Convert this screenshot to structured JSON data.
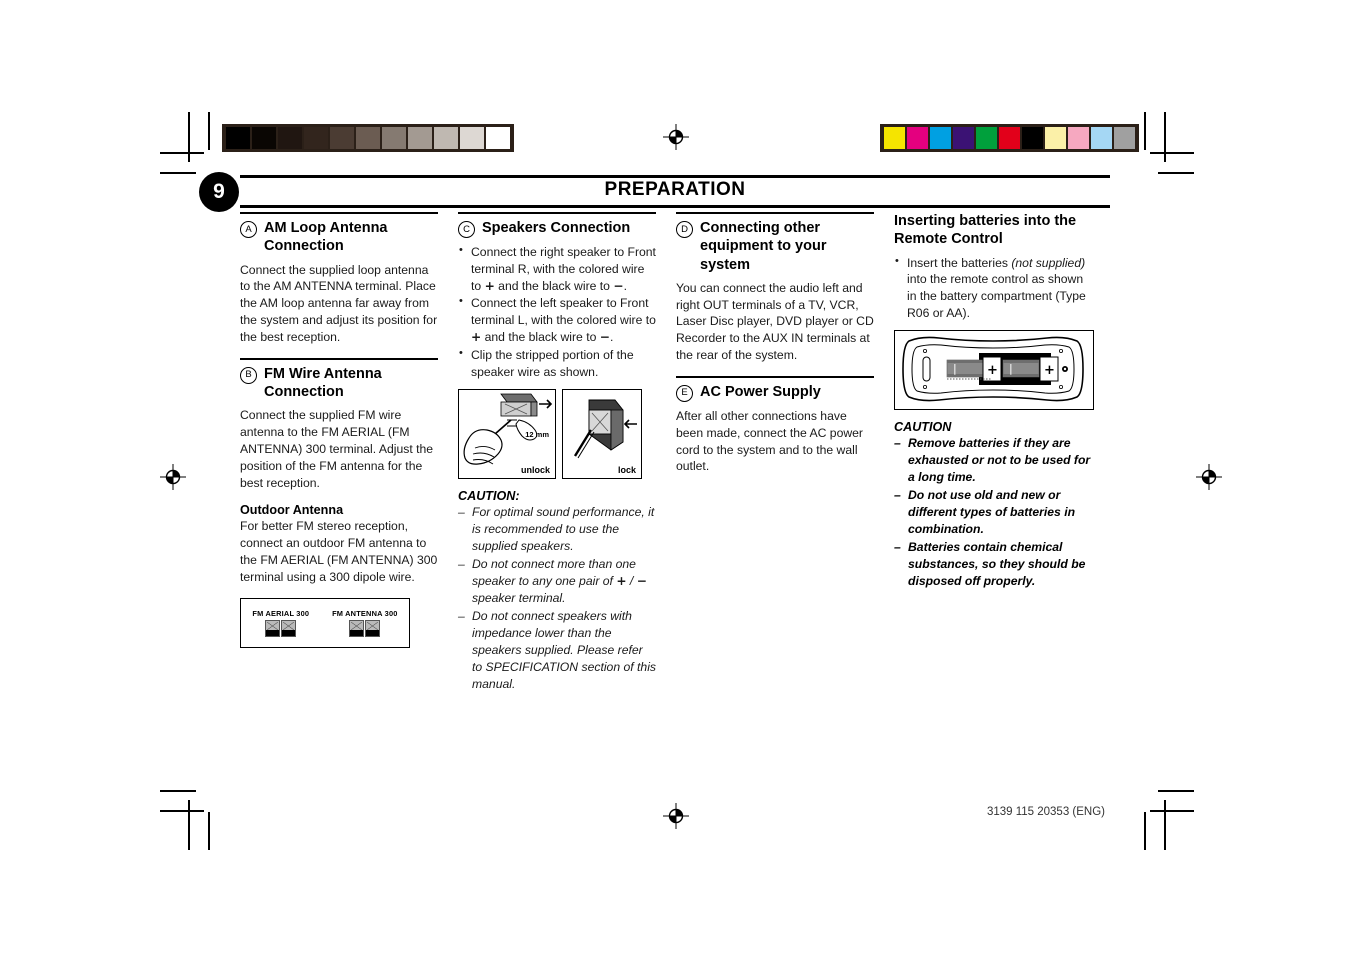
{
  "document": {
    "page_number": "9",
    "title": "PREPARATION",
    "footer_code": "3139 115 20353 (ENG)"
  },
  "calibration": {
    "grayscale_swatches": [
      "#000000",
      "#0a0603",
      "#201611",
      "#32251d",
      "#4b3c33",
      "#6b5c52",
      "#857a71",
      "#a39a92",
      "#bfb8b1",
      "#ddd8d3",
      "#ffffff"
    ],
    "color_swatches": [
      "#f5e400",
      "#e4007f",
      "#00a0e2",
      "#3b1274",
      "#00a03c",
      "#e2001a",
      "#000000",
      "#fbf0a8",
      "#f6a8c0",
      "#a5d7f4",
      "#a0a0a0"
    ]
  },
  "columns": [
    {
      "id": "column-1",
      "sections": [
        {
          "id": "am-loop-antenna",
          "letter": "A",
          "heading": "AM Loop Antenna Connection",
          "body": "Connect the supplied loop antenna to the AM ANTENNA terminal. Place the AM loop antenna far away from the system and adjust its position for the best reception."
        },
        {
          "id": "fm-wire-antenna",
          "letter": "B",
          "heading": "FM Wire Antenna Connection",
          "body": "Connect the supplied FM wire antenna to the FM AERIAL (FM ANTENNA) 300     terminal. Adjust the position of the FM antenna for the best reception.",
          "subheading": "Outdoor Antenna",
          "sub_body": "For better FM stereo reception, connect an outdoor FM antenna to the FM AERIAL (FM ANTENNA) 300 terminal using a 300     dipole wire.",
          "figure": {
            "name": "antenna-terminals-diagram",
            "labels": [
              "FM AERIAL 300",
              "FM ANTENNA 300"
            ]
          }
        }
      ]
    },
    {
      "id": "column-2",
      "sections": [
        {
          "id": "speakers-connection",
          "letter": "C",
          "heading": "Speakers Connection",
          "bullets": [
            "Connect the right speaker to Front terminal R, with the colored wire to + and the black wire to −.",
            "Connect the left speaker to Front terminal L, with the colored wire to + and the black wire to −.",
            "Clip the stripped portion of the speaker wire as shown."
          ],
          "figure": {
            "name": "speaker-wire-clip-diagram",
            "left_caption": "unlock",
            "left_measure": "12 mm",
            "right_caption": "lock"
          },
          "caution_title": "CAUTION:",
          "caution_items": [
            "For optimal sound performance, it is recommended to use the supplied speakers.",
            "Do not connect more than one speaker to any one pair of + / − speaker terminal.",
            "Do not connect speakers with impedance lower than the speakers supplied.  Please refer to SPECIFICATION section of this manual."
          ]
        }
      ]
    },
    {
      "id": "column-3",
      "sections": [
        {
          "id": "connecting-other-equipment",
          "letter": "D",
          "heading": "Connecting other equipment to your system",
          "body": "You can connect the audio left and right OUT terminals of a  TV, VCR, Laser Disc player, DVD player or CD Recorder to the AUX IN terminals at the rear of the system."
        },
        {
          "id": "ac-power-supply",
          "letter": "E",
          "heading": "AC Power Supply",
          "body": "After all other connections have been made, connect the AC power cord to the system and to the wall outlet."
        }
      ]
    },
    {
      "id": "column-4",
      "sections": [
        {
          "id": "inserting-batteries",
          "letter": "",
          "heading": "Inserting batteries into the Remote Control",
          "bullets": [
            "Insert the batteries (not supplied) into the remote control as shown in the battery compartment (Type R06 or AA)."
          ],
          "bullet_italic_part": "(not supplied)",
          "figure": {
            "name": "remote-control-battery-diagram",
            "polarity_marks": [
              "+",
              "−"
            ]
          },
          "caution_title": "CAUTION",
          "caution_items": [
            "Remove batteries if they are exhausted or not to be used for a long time.",
            "Do not use old and new or different types of batteries in combination.",
            "Batteries contain chemical substances, so they should be disposed off properly."
          ]
        }
      ]
    }
  ]
}
